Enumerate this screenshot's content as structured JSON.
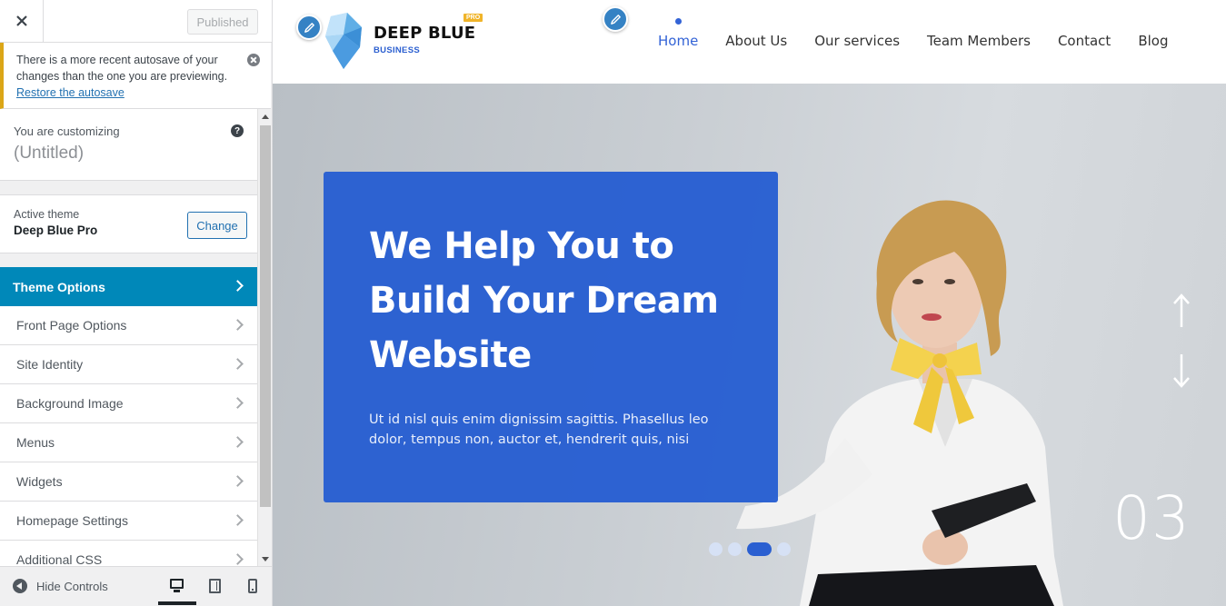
{
  "sidebar": {
    "publish_label": "Published",
    "notice": {
      "text": "There is a more recent autosave of your changes than the one you are previewing.",
      "link": "Restore the autosave"
    },
    "customizing": {
      "pre": "You are customizing",
      "title": "(Untitled)"
    },
    "active_theme": {
      "label": "Active theme",
      "name": "Deep Blue Pro",
      "change_label": "Change"
    },
    "items": [
      {
        "label": "Theme Options"
      },
      {
        "label": "Front Page Options"
      },
      {
        "label": "Site Identity"
      },
      {
        "label": "Background Image"
      },
      {
        "label": "Menus"
      },
      {
        "label": "Widgets"
      },
      {
        "label": "Homepage Settings"
      },
      {
        "label": "Additional CSS"
      }
    ],
    "hide_controls": "Hide Controls"
  },
  "site": {
    "logo_title": "DEEP BLUE",
    "logo_sub": "BUSINESS",
    "logo_badge": "PRO",
    "nav": [
      "Home",
      "About Us",
      "Our services",
      "Team Members",
      "Contact",
      "Blog"
    ],
    "hero": {
      "title": "We Help You to Build Your Dream Website",
      "text": "Ut id nisl quis enim dignissim sagittis. Phasellus leo dolor, tempus non, auctor et, hendrerit quis, nisi",
      "slide_number": "03"
    }
  },
  "colors": {
    "accent": "#0088b9",
    "brand": "#2a5fd1",
    "notice": "#dba617"
  }
}
